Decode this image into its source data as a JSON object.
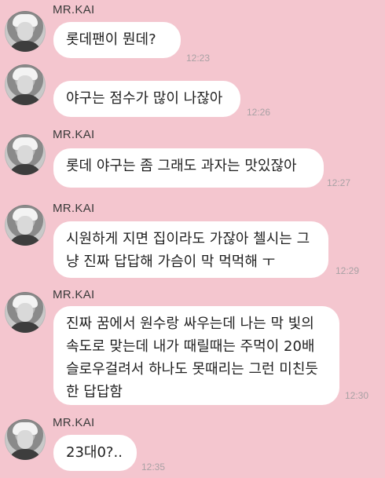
{
  "sender_name": "MR.KAI",
  "messages": [
    {
      "text": "롯데팬이 뭔데?",
      "time": "12:23",
      "show_name": true
    },
    {
      "text": "야구는 점수가 많이 나잖아",
      "time": "12:26",
      "show_name": false
    },
    {
      "text": "롯데 야구는 좀 그래도 과자는 맛있잖아",
      "time": "12:27",
      "show_name": true
    },
    {
      "text": "시원하게 지면 집이라도 가잖아 첼시는 그\n냥 진짜 답답해 가슴이 막 먹먹해 ㅜ",
      "time": "12:29",
      "show_name": true
    },
    {
      "text": "진짜 꿈에서 원수랑 싸우는데 나는 막 빛의\n속도로 맞는데 내가 때릴때는 주먹이 20배\n슬로우걸려서 하나도 못때리는 그런 미친듯\n한 답답함",
      "time": "12:30",
      "show_name": true
    },
    {
      "text": "23대0?..",
      "time": "12:35",
      "show_name": true
    }
  ],
  "colors": {
    "background": "#f4c6cf",
    "bubble": "#ffffff",
    "time": "#a8a1a4"
  }
}
